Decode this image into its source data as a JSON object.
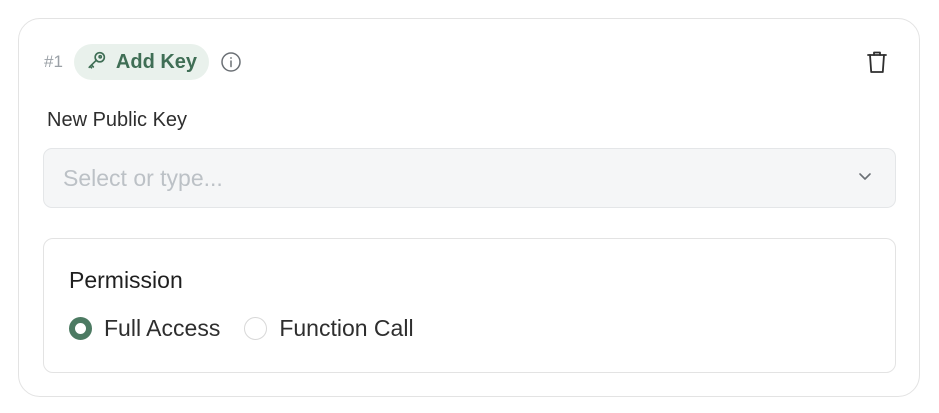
{
  "action": {
    "index": "#1",
    "label": "Add Key",
    "icon": "key-icon",
    "info_icon": "info-icon",
    "delete_icon": "trash-icon"
  },
  "public_key": {
    "label": "New Public Key",
    "value": "",
    "placeholder": "Select or type...",
    "dropdown_icon": "chevron-down-icon"
  },
  "permission": {
    "title": "Permission",
    "options": [
      {
        "label": "Full Access",
        "selected": true
      },
      {
        "label": "Function Call",
        "selected": false
      }
    ]
  },
  "colors": {
    "accent": "#4c7a62",
    "chip_bg": "#e9f1ec",
    "chip_text": "#3f6e55"
  }
}
